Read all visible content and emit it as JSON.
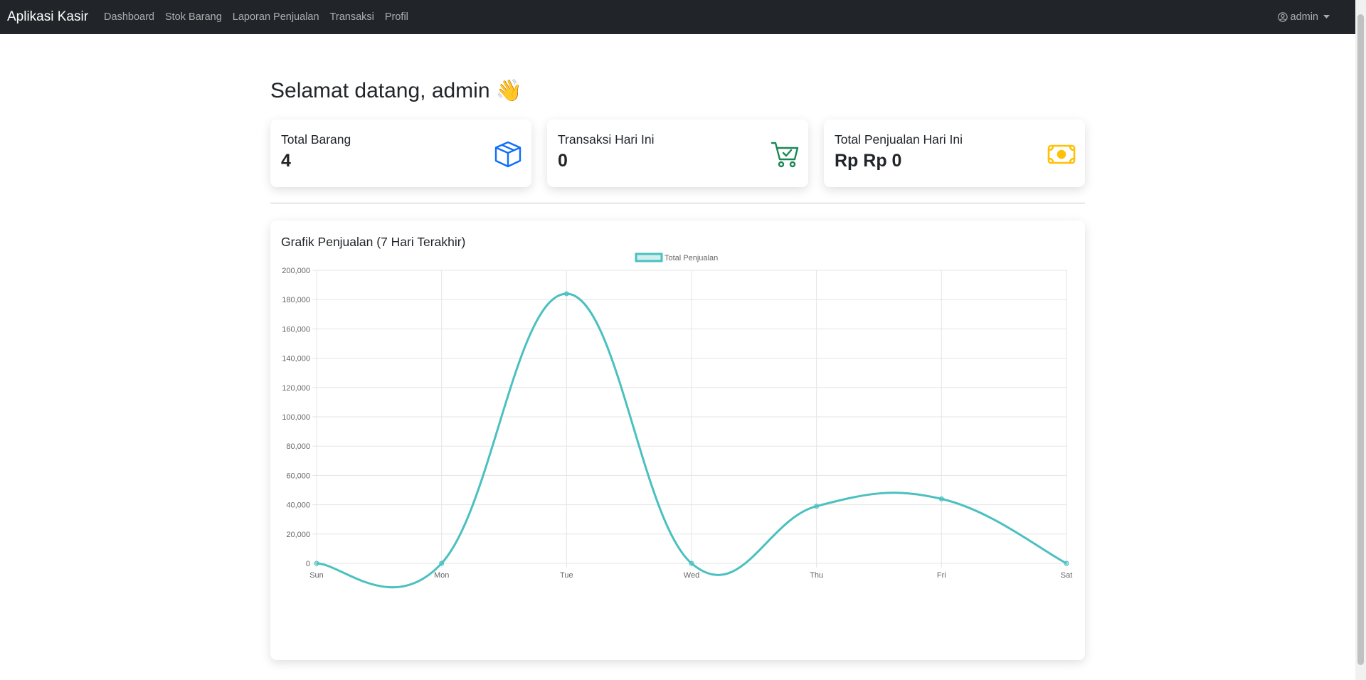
{
  "navbar": {
    "brand": "Aplikasi Kasir",
    "links": [
      "Dashboard",
      "Stok Barang",
      "Laporan Penjualan",
      "Transaksi",
      "Profil"
    ],
    "user": "admin"
  },
  "welcome": "Selamat datang, admin 👋",
  "stats": [
    {
      "label": "Total Barang",
      "value": "4",
      "icon": "box-icon",
      "color": "#0d6efd"
    },
    {
      "label": "Transaksi Hari Ini",
      "value": "0",
      "icon": "cart-check-icon",
      "color": "#198754"
    },
    {
      "label": "Total Penjualan Hari Ini",
      "value": "Rp Rp 0",
      "icon": "cash-icon",
      "color": "#ffc107"
    }
  ],
  "chart_title": "Grafik Penjualan (7 Hari Terakhir)",
  "chart_data": {
    "type": "line",
    "categories": [
      "Sun",
      "Mon",
      "Tue",
      "Wed",
      "Thu",
      "Fri",
      "Sat"
    ],
    "series": [
      {
        "name": "Total Penjualan",
        "values": [
          0,
          0,
          184000,
          0,
          39000,
          44000,
          0
        ],
        "color": "#4bc0c0"
      }
    ],
    "ylim": [
      0,
      200000
    ],
    "yticks": [
      "200,000",
      "180,000",
      "160,000",
      "140,000",
      "120,000",
      "100,000",
      "80,000",
      "60,000",
      "40,000",
      "20,000",
      "0"
    ],
    "legend": "top",
    "grid": true,
    "smooth": true
  }
}
